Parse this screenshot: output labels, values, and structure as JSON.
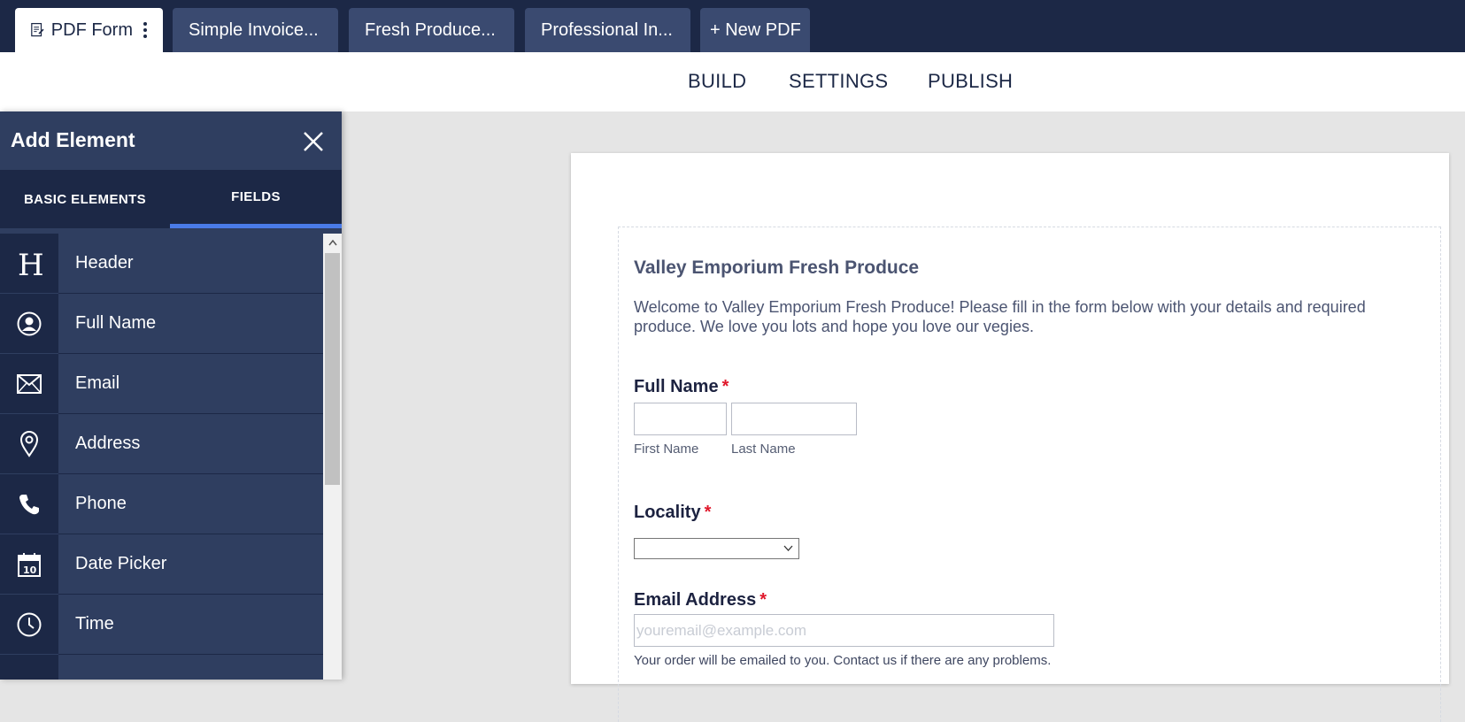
{
  "tabs": [
    {
      "label": "PDF Form",
      "active": true
    },
    {
      "label": "Simple Invoice..."
    },
    {
      "label": "Fresh Produce..."
    },
    {
      "label": "Professional In..."
    },
    {
      "label": "+ New PDF"
    }
  ],
  "subnav": {
    "build": "BUILD",
    "settings": "SETTINGS",
    "publish": "PUBLISH"
  },
  "panel": {
    "title": "Add Element",
    "tab_basic": "BASIC ELEMENTS",
    "tab_fields": "FIELDS",
    "items": [
      {
        "label": "Header",
        "icon": "header-icon"
      },
      {
        "label": "Full Name",
        "icon": "user-icon"
      },
      {
        "label": "Email",
        "icon": "envelope-icon"
      },
      {
        "label": "Address",
        "icon": "map-pin-icon"
      },
      {
        "label": "Phone",
        "icon": "phone-icon"
      },
      {
        "label": "Date Picker",
        "icon": "calendar-icon"
      },
      {
        "label": "Time",
        "icon": "clock-icon"
      }
    ]
  },
  "form": {
    "title": "Valley Emporium Fresh Produce",
    "description": "Welcome to Valley Emporium Fresh Produce! Please fill in the form below with your details and required produce. We love you lots and hope you love our vegies.",
    "full_name_label": "Full Name",
    "first_name_sublabel": "First Name",
    "last_name_sublabel": "Last Name",
    "locality_label": "Locality",
    "email_label": "Email Address",
    "email_placeholder": "youremail@example.com",
    "email_note": "Your order will be emailed to you. Contact us if there are any problems.",
    "required_mark": "*"
  },
  "colors": {
    "nav_dark": "#1c2846",
    "panel": "#2f3e60",
    "accent": "#4a7be8",
    "required": "#e0182b"
  }
}
